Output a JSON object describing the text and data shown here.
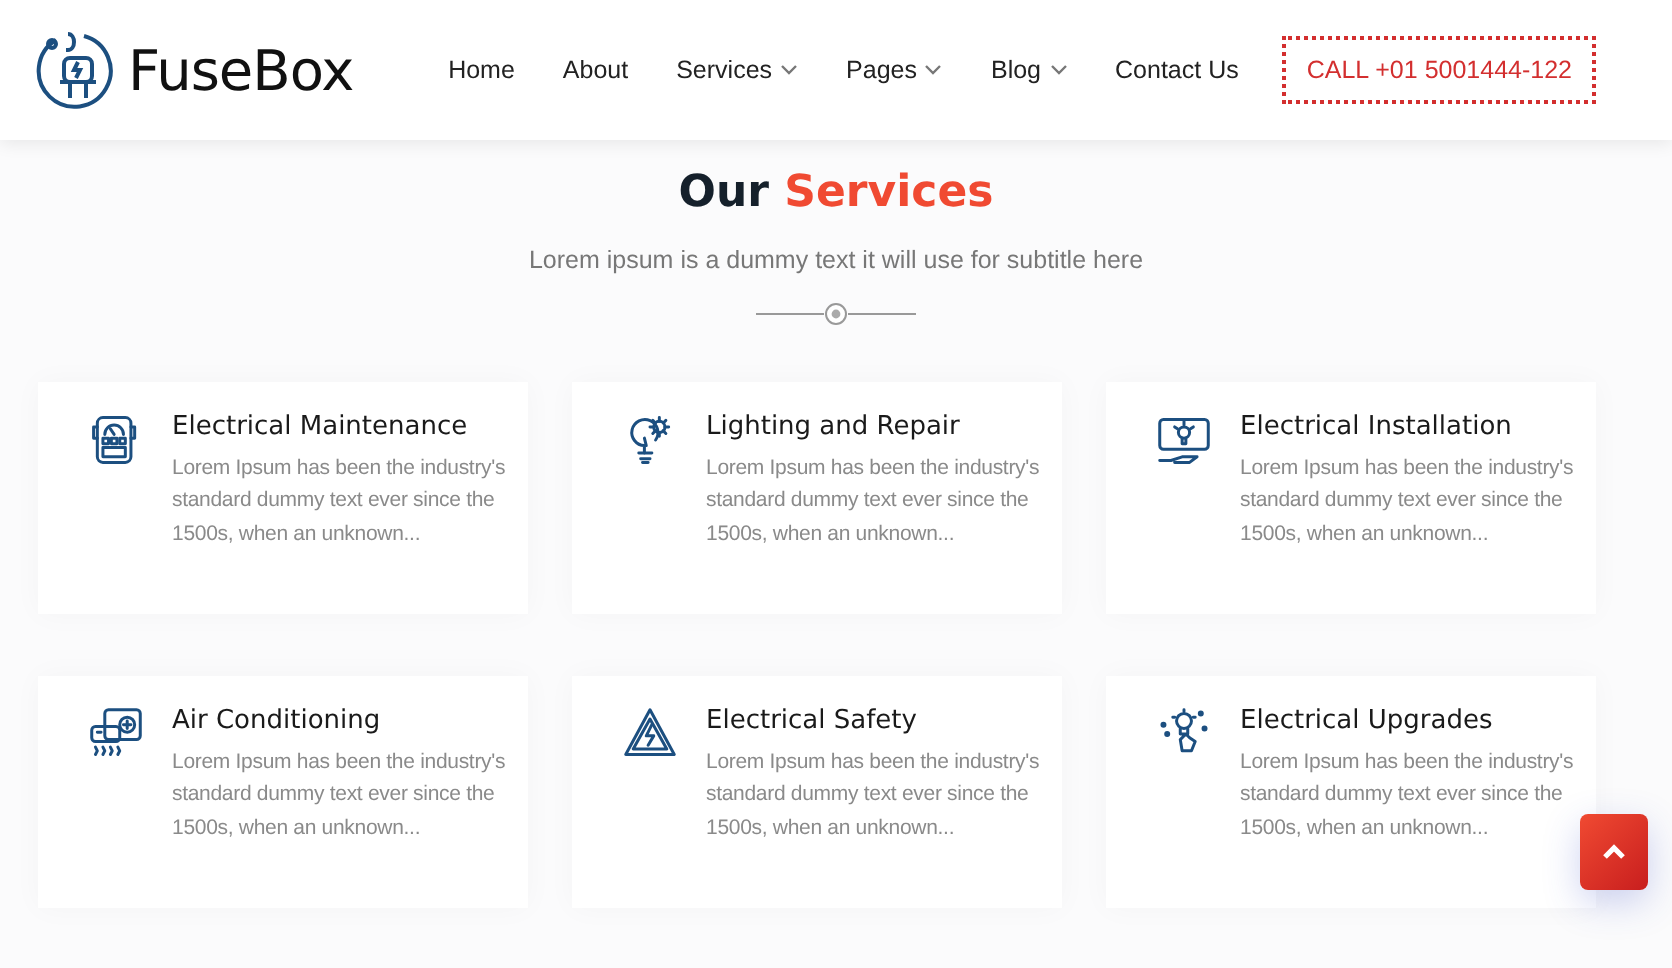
{
  "brand": {
    "name": "FuseBox"
  },
  "nav": [
    {
      "label": "Home",
      "dropdown": false
    },
    {
      "label": "About",
      "dropdown": false
    },
    {
      "label": "Services",
      "dropdown": true
    },
    {
      "label": "Pages",
      "dropdown": true
    },
    {
      "label": "Blog",
      "dropdown": true
    },
    {
      "label": "Contact Us",
      "dropdown": false
    }
  ],
  "call_button": "CALL +01 5001444-122",
  "section": {
    "title_plain": "Our",
    "title_accent": "Services",
    "subtitle": "Lorem ipsum is a dummy text it will use for subtitle here"
  },
  "services": [
    {
      "kind": "meter",
      "title": "Electrical Maintenance",
      "text": "Lorem Ipsum has been the industry's standard dummy text ever since the 1500s, when an unknown..."
    },
    {
      "kind": "bulb-gear",
      "title": "Lighting and Repair",
      "text": "Lorem Ipsum has been the industry's standard dummy text ever since the 1500s, when an unknown..."
    },
    {
      "kind": "monitor",
      "title": "Electrical Installation",
      "text": "Lorem Ipsum has been the industry's standard dummy text ever since the 1500s, when an unknown..."
    },
    {
      "kind": "ac",
      "title": "Air Conditioning",
      "text": "Lorem Ipsum has been the industry's standard dummy text ever since the 1500s, when an unknown..."
    },
    {
      "kind": "warning",
      "title": "Electrical Safety",
      "text": "Lorem Ipsum has been the industry's standard dummy text ever since the 1500s, when an unknown..."
    },
    {
      "kind": "hand-bulb",
      "title": "Electrical Upgrades",
      "text": "Lorem Ipsum has been the industry's standard dummy text ever since the 1500s, when an unknown..."
    }
  ]
}
